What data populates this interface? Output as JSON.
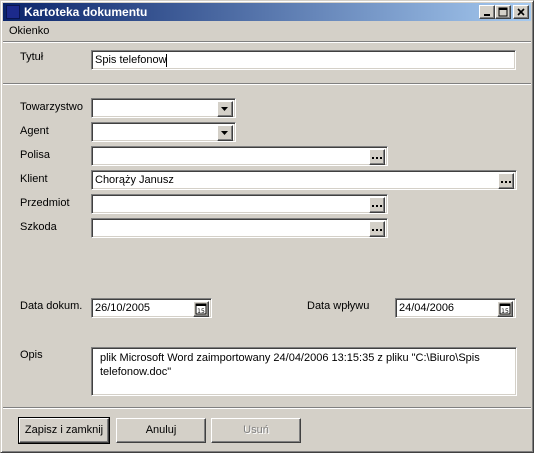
{
  "window": {
    "title": "Kartoteka dokumentu"
  },
  "menu": {
    "items": [
      "Okienko"
    ]
  },
  "form": {
    "title": {
      "label": "Tytuł",
      "value": "Spis telefonow"
    },
    "towarzystwo": {
      "label": "Towarzystwo",
      "value": ""
    },
    "agent": {
      "label": "Agent",
      "value": ""
    },
    "polisa": {
      "label": "Polisa",
      "value": ""
    },
    "klient": {
      "label": "Klient",
      "value": "Chorąży Janusz"
    },
    "przedmiot": {
      "label": "Przedmiot",
      "value": ""
    },
    "szkoda": {
      "label": "Szkoda",
      "value": ""
    },
    "data_dokum": {
      "label": "Data dokum.",
      "value": "26/10/2005"
    },
    "data_wplywu": {
      "label": "Data wpływu",
      "value": "24/04/2006"
    },
    "opis": {
      "label": "Opis",
      "value": "plik Microsoft Word zaimportowany 24/04/2006 13:15:35 z pliku \"C:\\Biuro\\Spis telefonow.doc\""
    }
  },
  "buttons": {
    "save": "Zapisz i zamknij",
    "cancel": "Anuluj",
    "delete": "Usuń"
  },
  "calendar_glyph": "15",
  "ellipsis_glyph": "..."
}
